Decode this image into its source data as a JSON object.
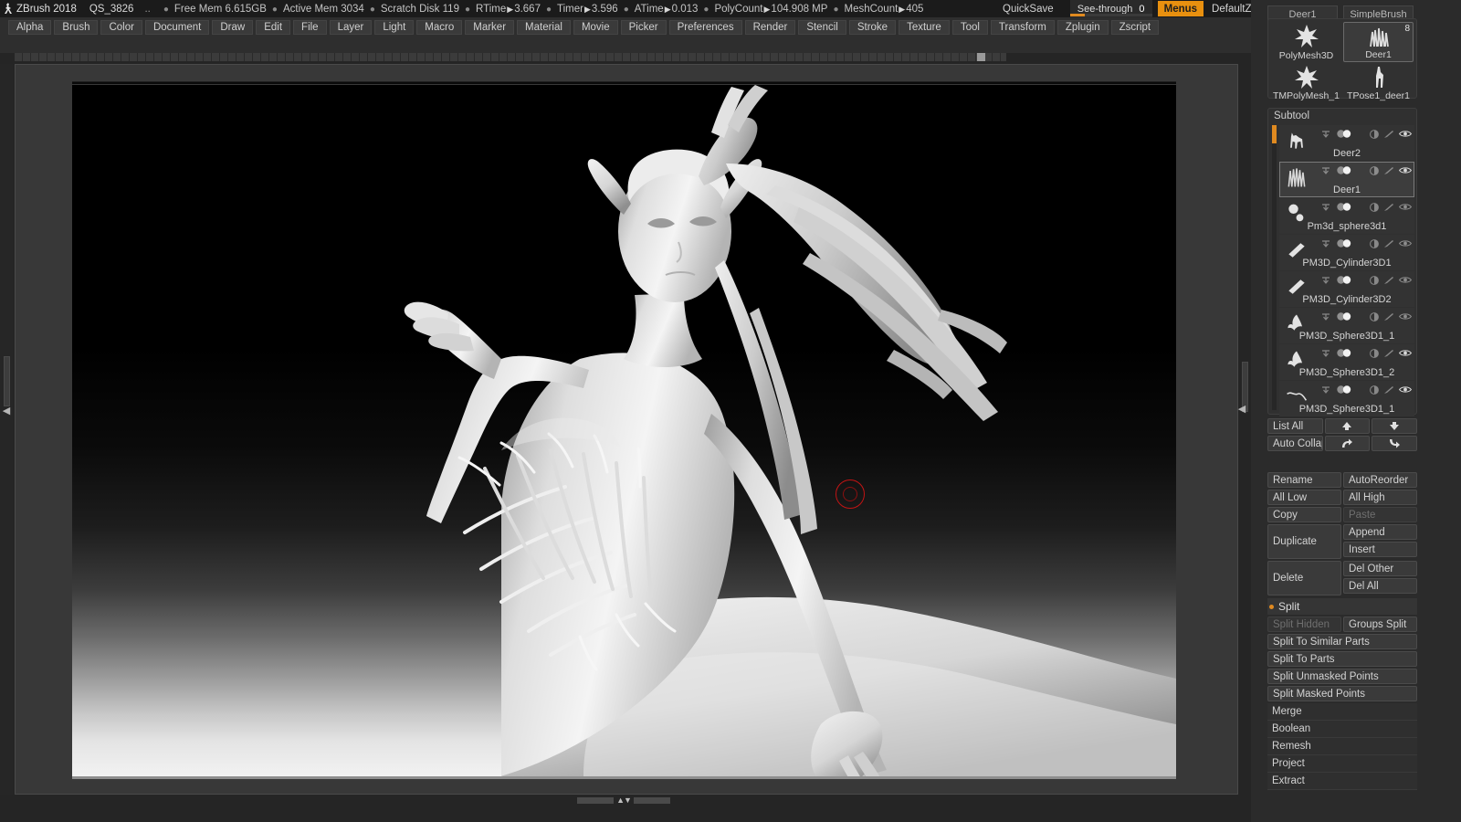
{
  "titlebar": {
    "logo_icon": "zbrush-logo-icon",
    "app_name": "ZBrush 2018",
    "quicksave_name": "QS_3826",
    "dots": "..",
    "stats": [
      {
        "label": "Free Mem",
        "value": "6.615GB",
        "arrow": false
      },
      {
        "label": "Active Mem",
        "value": "3034",
        "arrow": false
      },
      {
        "label": "Scratch Disk",
        "value": "119",
        "arrow": false
      },
      {
        "label": "RTime",
        "value": "3.667",
        "arrow": true
      },
      {
        "label": "Timer",
        "value": "3.596",
        "arrow": true
      },
      {
        "label": "ATime",
        "value": "0.013",
        "arrow": true
      },
      {
        "label": "PolyCount",
        "value": "104.908 MP",
        "arrow": true
      },
      {
        "label": "MeshCount",
        "value": "405",
        "arrow": true
      }
    ],
    "quicksave_label": "QuickSave",
    "seethrough_label": "See-through",
    "seethrough_value": "0",
    "menus_label": "Menus",
    "zscript_label": "DefaultZScript",
    "icons": [
      "bar-grip-left-icon",
      "bar-grip-right-icon",
      "tray-left-icon",
      "tray-right-icon",
      "lock-icon",
      "minimize-icon",
      "restore-icon",
      "close-icon"
    ]
  },
  "menubar": {
    "items": [
      "Alpha",
      "Brush",
      "Color",
      "Document",
      "Draw",
      "Edit",
      "File",
      "Layer",
      "Light",
      "Macro",
      "Marker",
      "Material",
      "Movie",
      "Picker",
      "Preferences",
      "Render",
      "Stencil",
      "Stroke",
      "Texture",
      "Tool",
      "Transform",
      "Zplugin",
      "Zscript"
    ]
  },
  "canvas": {
    "brush_cursor_icon": "brush-cursor-icon",
    "left_tray_arrow": "◀",
    "right_tray_arrow": "◀",
    "bottom_zoom_arrows": "▲▼"
  },
  "tool_palette": {
    "tabs": [
      {
        "label": "Deer1"
      },
      {
        "label": "SimpleBrush"
      }
    ],
    "thumbs": [
      {
        "label": "PolyMesh3D",
        "icon": "star-mesh-icon",
        "selected": false,
        "badge": ""
      },
      {
        "label": "Deer1",
        "icon": "deer-antler-icon",
        "selected": true,
        "badge": "8"
      },
      {
        "label": "TMPolyMesh_1",
        "icon": "star-mesh-icon",
        "selected": false,
        "badge": ""
      },
      {
        "label": "TPose1_deer1",
        "icon": "deer-figure-icon",
        "selected": false,
        "badge": ""
      }
    ]
  },
  "subtool": {
    "title": "Subtool",
    "items": [
      {
        "name": "Deer2",
        "thumb": "deer-icon",
        "visible": true,
        "selected": false
      },
      {
        "name": "Deer1",
        "thumb": "antlers-icon",
        "visible": true,
        "selected": true
      },
      {
        "name": "Pm3d_sphere3d1",
        "thumb": "spheres-icon",
        "visible": false,
        "selected": false
      },
      {
        "name": "PM3D_Cylinder3D1",
        "thumb": "cylinder-icon",
        "visible": false,
        "selected": false
      },
      {
        "name": "PM3D_Cylinder3D2",
        "thumb": "cylinder-icon",
        "visible": false,
        "selected": false
      },
      {
        "name": "PM3D_Sphere3D1_1",
        "thumb": "tendril-icon",
        "visible": false,
        "selected": false
      },
      {
        "name": "PM3D_Sphere3D1_2",
        "thumb": "tendril-icon",
        "visible": true,
        "selected": false
      },
      {
        "name": "PM3D_Sphere3D1_1",
        "thumb": "curve-icon",
        "visible": true,
        "selected": false
      }
    ],
    "row_icons": [
      "polypaint-arrow-icon",
      "visibility-toggle-icon",
      "shading-icon",
      "contrast-icon",
      "brush-icon",
      "eye-icon"
    ]
  },
  "subtool_controls": {
    "list_all": "List All",
    "auto_collapse": "Auto Collapse",
    "move_up_icon": "arrow-up-icon",
    "move_down_icon": "arrow-down-icon",
    "indent_out_icon": "arrow-turn-up-icon",
    "indent_in_icon": "arrow-turn-down-icon",
    "rename": "Rename",
    "auto_reorder": "AutoReorder",
    "all_low": "All Low",
    "all_high": "All High",
    "copy": "Copy",
    "paste": "Paste",
    "duplicate": "Duplicate",
    "append": "Append",
    "insert": "Insert",
    "delete": "Delete",
    "del_other": "Del Other",
    "del_all": "Del All"
  },
  "split_section": {
    "title": "Split",
    "split_hidden": "Split Hidden",
    "groups_split": "Groups Split",
    "split_to_similar_parts": "Split To Similar Parts",
    "split_to_parts": "Split To Parts",
    "split_unmasked_points": "Split Unmasked Points",
    "split_masked_points": "Split Masked Points"
  },
  "sub_sections": [
    {
      "label": "Merge"
    },
    {
      "label": "Boolean"
    },
    {
      "label": "Remesh"
    },
    {
      "label": "Project"
    },
    {
      "label": "Extract"
    }
  ],
  "colors": {
    "accent": "#e8900f",
    "panel_bg": "#2b2b2b",
    "titlebar_bg": "#1b1b1b",
    "menubar_bg": "#2e2e2e",
    "button_bg": "#3a3a3a",
    "text": "#d3d3d3",
    "cursor_red": "#cc1414"
  }
}
